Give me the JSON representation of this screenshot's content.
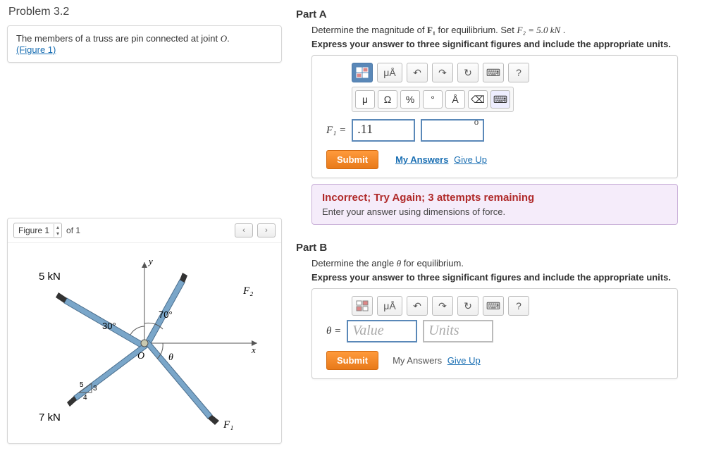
{
  "problem": {
    "title": "Problem 3.2",
    "statement_pre": "The members of a truss are pin connected at joint ",
    "statement_var": "O",
    "statement_post": ".",
    "figure_link": "(Figure 1)"
  },
  "figure": {
    "selector_label": "Figure 1",
    "of_text": "of 1",
    "labels": {
      "tl": "5 kN",
      "bl": "7 kN",
      "br": "F₁",
      "tr": "F₂",
      "angle_tl": "30°",
      "angle_tr": "70°",
      "theta": "θ",
      "origin": "O",
      "xaxis": "x",
      "yaxis": "y",
      "tri_a": "5",
      "tri_b": "3",
      "tri_c": "4"
    }
  },
  "partA": {
    "title": "Part A",
    "prompt_pre": "Determine the magnitude of ",
    "prompt_var": "F₁",
    "prompt_mid": " for equilibrium. Set ",
    "prompt_set": "F₂ = 5.0 kN",
    "prompt_post": " .",
    "instruction": "Express your answer to three significant figures and include the appropriate units.",
    "eq_label": "F₁ =",
    "value": ".11",
    "unit_superscript": "o",
    "toolbar": {
      "templates": "⊞",
      "units": "μÅ",
      "undo_icon": "↶",
      "redo_icon": "↷",
      "reset_icon": "↻",
      "keyboard_icon": "⌨",
      "help_icon": "?"
    },
    "symbols": [
      "μ",
      "Ω",
      "%",
      "°",
      "Å",
      "⌫",
      "⌨"
    ],
    "submit": "Submit",
    "my_answers": "My Answers",
    "give_up": "Give Up"
  },
  "feedback": {
    "title": "Incorrect; Try Again; 3 attempts remaining",
    "text": "Enter your answer using dimensions of force."
  },
  "partB": {
    "title": "Part B",
    "prompt_pre": "Determine the angle ",
    "prompt_var": "θ",
    "prompt_post": " for equilibrium.",
    "instruction": "Express your answer to three significant figures and include the appropriate units.",
    "eq_label": "θ =",
    "value_ph": "Value",
    "unit_ph": "Units",
    "submit": "Submit",
    "my_answers": "My Answers",
    "give_up": "Give Up"
  }
}
